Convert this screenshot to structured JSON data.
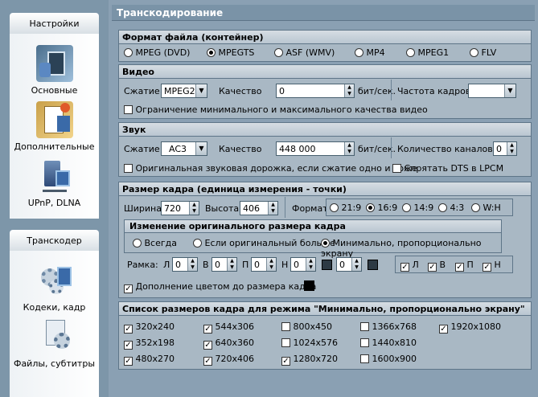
{
  "sidebar": {
    "header1": "Настройки",
    "items1": [
      {
        "label": "Основные",
        "icon": "film-settings-icon"
      },
      {
        "label": "Дополнительные",
        "icon": "clipboard-film-icon"
      },
      {
        "label": "UPnP, DLNA",
        "icon": "network-server-icon"
      }
    ],
    "header2": "Транскодер",
    "items2": [
      {
        "label": "Кодеки, кадр",
        "icon": "gears-film-icon"
      },
      {
        "label": "Файлы, субтитры",
        "icon": "file-gear-icon"
      }
    ]
  },
  "main": {
    "title": "Транскодирование"
  },
  "format": {
    "title": "Формат файла (контейнер)",
    "options": [
      "MPEG (DVD)",
      "MPEGTS",
      "ASF (WMV)",
      "MP4",
      "MPEG1",
      "FLV"
    ],
    "selected": "MPEGTS"
  },
  "video": {
    "title": "Видео",
    "compression_label": "Сжатие",
    "compression_value": "MPEG2",
    "quality_label": "Качество",
    "quality_value": "0",
    "unit": "бит/сек.",
    "framerate_label": "Частота кадров",
    "framerate_value": "",
    "limit_label": "Ограничение минимального и максимального качества видео"
  },
  "audio": {
    "title": "Звук",
    "compression_label": "Сжатие",
    "compression_value": "AC3",
    "quality_label": "Качество",
    "quality_value": "448 000",
    "unit": "бит/сек.",
    "channels_label": "Количество каналов",
    "channels_value": "0",
    "original_label": "Оригинальная звуковая дорожка, если сжатие одно и тоже",
    "hide_dts_label": "Спрятать DTS в LPCM"
  },
  "frame": {
    "title": "Размер кадра (единица измерения - точки)",
    "width_label": "Ширина",
    "width_value": "720",
    "height_label": "Высота",
    "height_value": "406",
    "format_label": "Формат",
    "format_options": [
      "21:9",
      "16:9",
      "14:9",
      "4:3",
      "W:H"
    ],
    "format_selected": "16:9",
    "resize_title": "Изменение оригинального размера кадра",
    "resize_options": [
      "Всегда",
      "Если оригинальный больше",
      "Минимально, пропорционально экрану"
    ],
    "resize_selected": "Минимально, пропорционально экрану",
    "border_label": "Рамка:",
    "border_fields": [
      {
        "label": "Л",
        "value": "0"
      },
      {
        "label": "В",
        "value": "0"
      },
      {
        "label": "П",
        "value": "0"
      },
      {
        "label": "Н",
        "value": "0"
      }
    ],
    "extra_value": "0",
    "sides": [
      {
        "label": "Л",
        "checked": true
      },
      {
        "label": "В",
        "checked": true
      },
      {
        "label": "П",
        "checked": true
      },
      {
        "label": "Н",
        "checked": true
      }
    ],
    "fill_label": "Дополнение цветом до размера кадра",
    "fill_color": "#000000"
  },
  "sizes": {
    "title": "Список размеров кадра для режима \"Минимально, пропорционально экрану\"",
    "items": [
      {
        "label": "320x240",
        "checked": true
      },
      {
        "label": "544x306",
        "checked": true
      },
      {
        "label": "800x450",
        "checked": false
      },
      {
        "label": "1366x768",
        "checked": false
      },
      {
        "label": "1920x1080",
        "checked": true
      },
      {
        "label": "352x198",
        "checked": true
      },
      {
        "label": "640x360",
        "checked": true
      },
      {
        "label": "1024x576",
        "checked": false
      },
      {
        "label": "1440x810",
        "checked": false
      },
      {
        "label": "480x270",
        "checked": true
      },
      {
        "label": "720x406",
        "checked": true
      },
      {
        "label": "1280x720",
        "checked": true
      },
      {
        "label": "1600x900",
        "checked": false
      }
    ]
  }
}
